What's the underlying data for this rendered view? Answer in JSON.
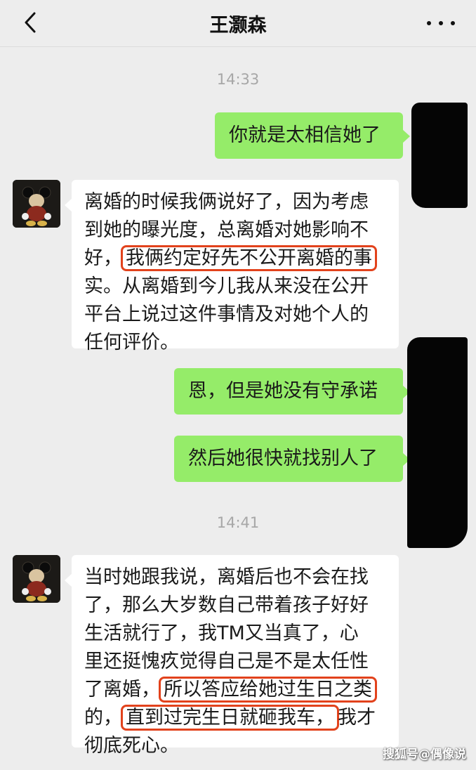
{
  "header": {
    "back_icon": "chevron-left-icon",
    "title": "王灏森",
    "more_icon": "ellipsis-icon"
  },
  "timestamps": [
    "14:33",
    "14:41"
  ],
  "messages": [
    {
      "side": "right",
      "lines": [
        "你就是太相信她了"
      ]
    },
    {
      "side": "left",
      "lines": [
        [
          "离婚的时候我俩说好了，因为考虑"
        ],
        [
          "到她的曝光度，总离婚对她影响不"
        ],
        [
          "好，",
          "我俩约定好先不公开离婚的事"
        ],
        [
          "实。从离婚到今儿我从来没在公开"
        ],
        [
          "平台上说过这件事情及对她个人的"
        ],
        [
          "任何评价。"
        ]
      ]
    },
    {
      "side": "right",
      "lines": [
        "恩，但是她没有守承诺"
      ]
    },
    {
      "side": "right",
      "lines": [
        "然后她很快就找别人了"
      ]
    },
    {
      "side": "left",
      "lines": [
        [
          "当时她跟我说，离婚后也不会在找"
        ],
        [
          "了，那么大岁数自己带着孩子好好"
        ],
        [
          "生活就行了，我TM又当真了，心"
        ],
        [
          "里还挺愧疚觉得自己是不是太任性"
        ],
        [
          "了离婚，",
          "所以答应给她过生日之类"
        ],
        [
          "的，",
          "直到过完生日就砸我车，",
          "我才"
        ],
        [
          "彻底死心。"
        ]
      ]
    }
  ],
  "watermark": "搜狐号@偶像说"
}
